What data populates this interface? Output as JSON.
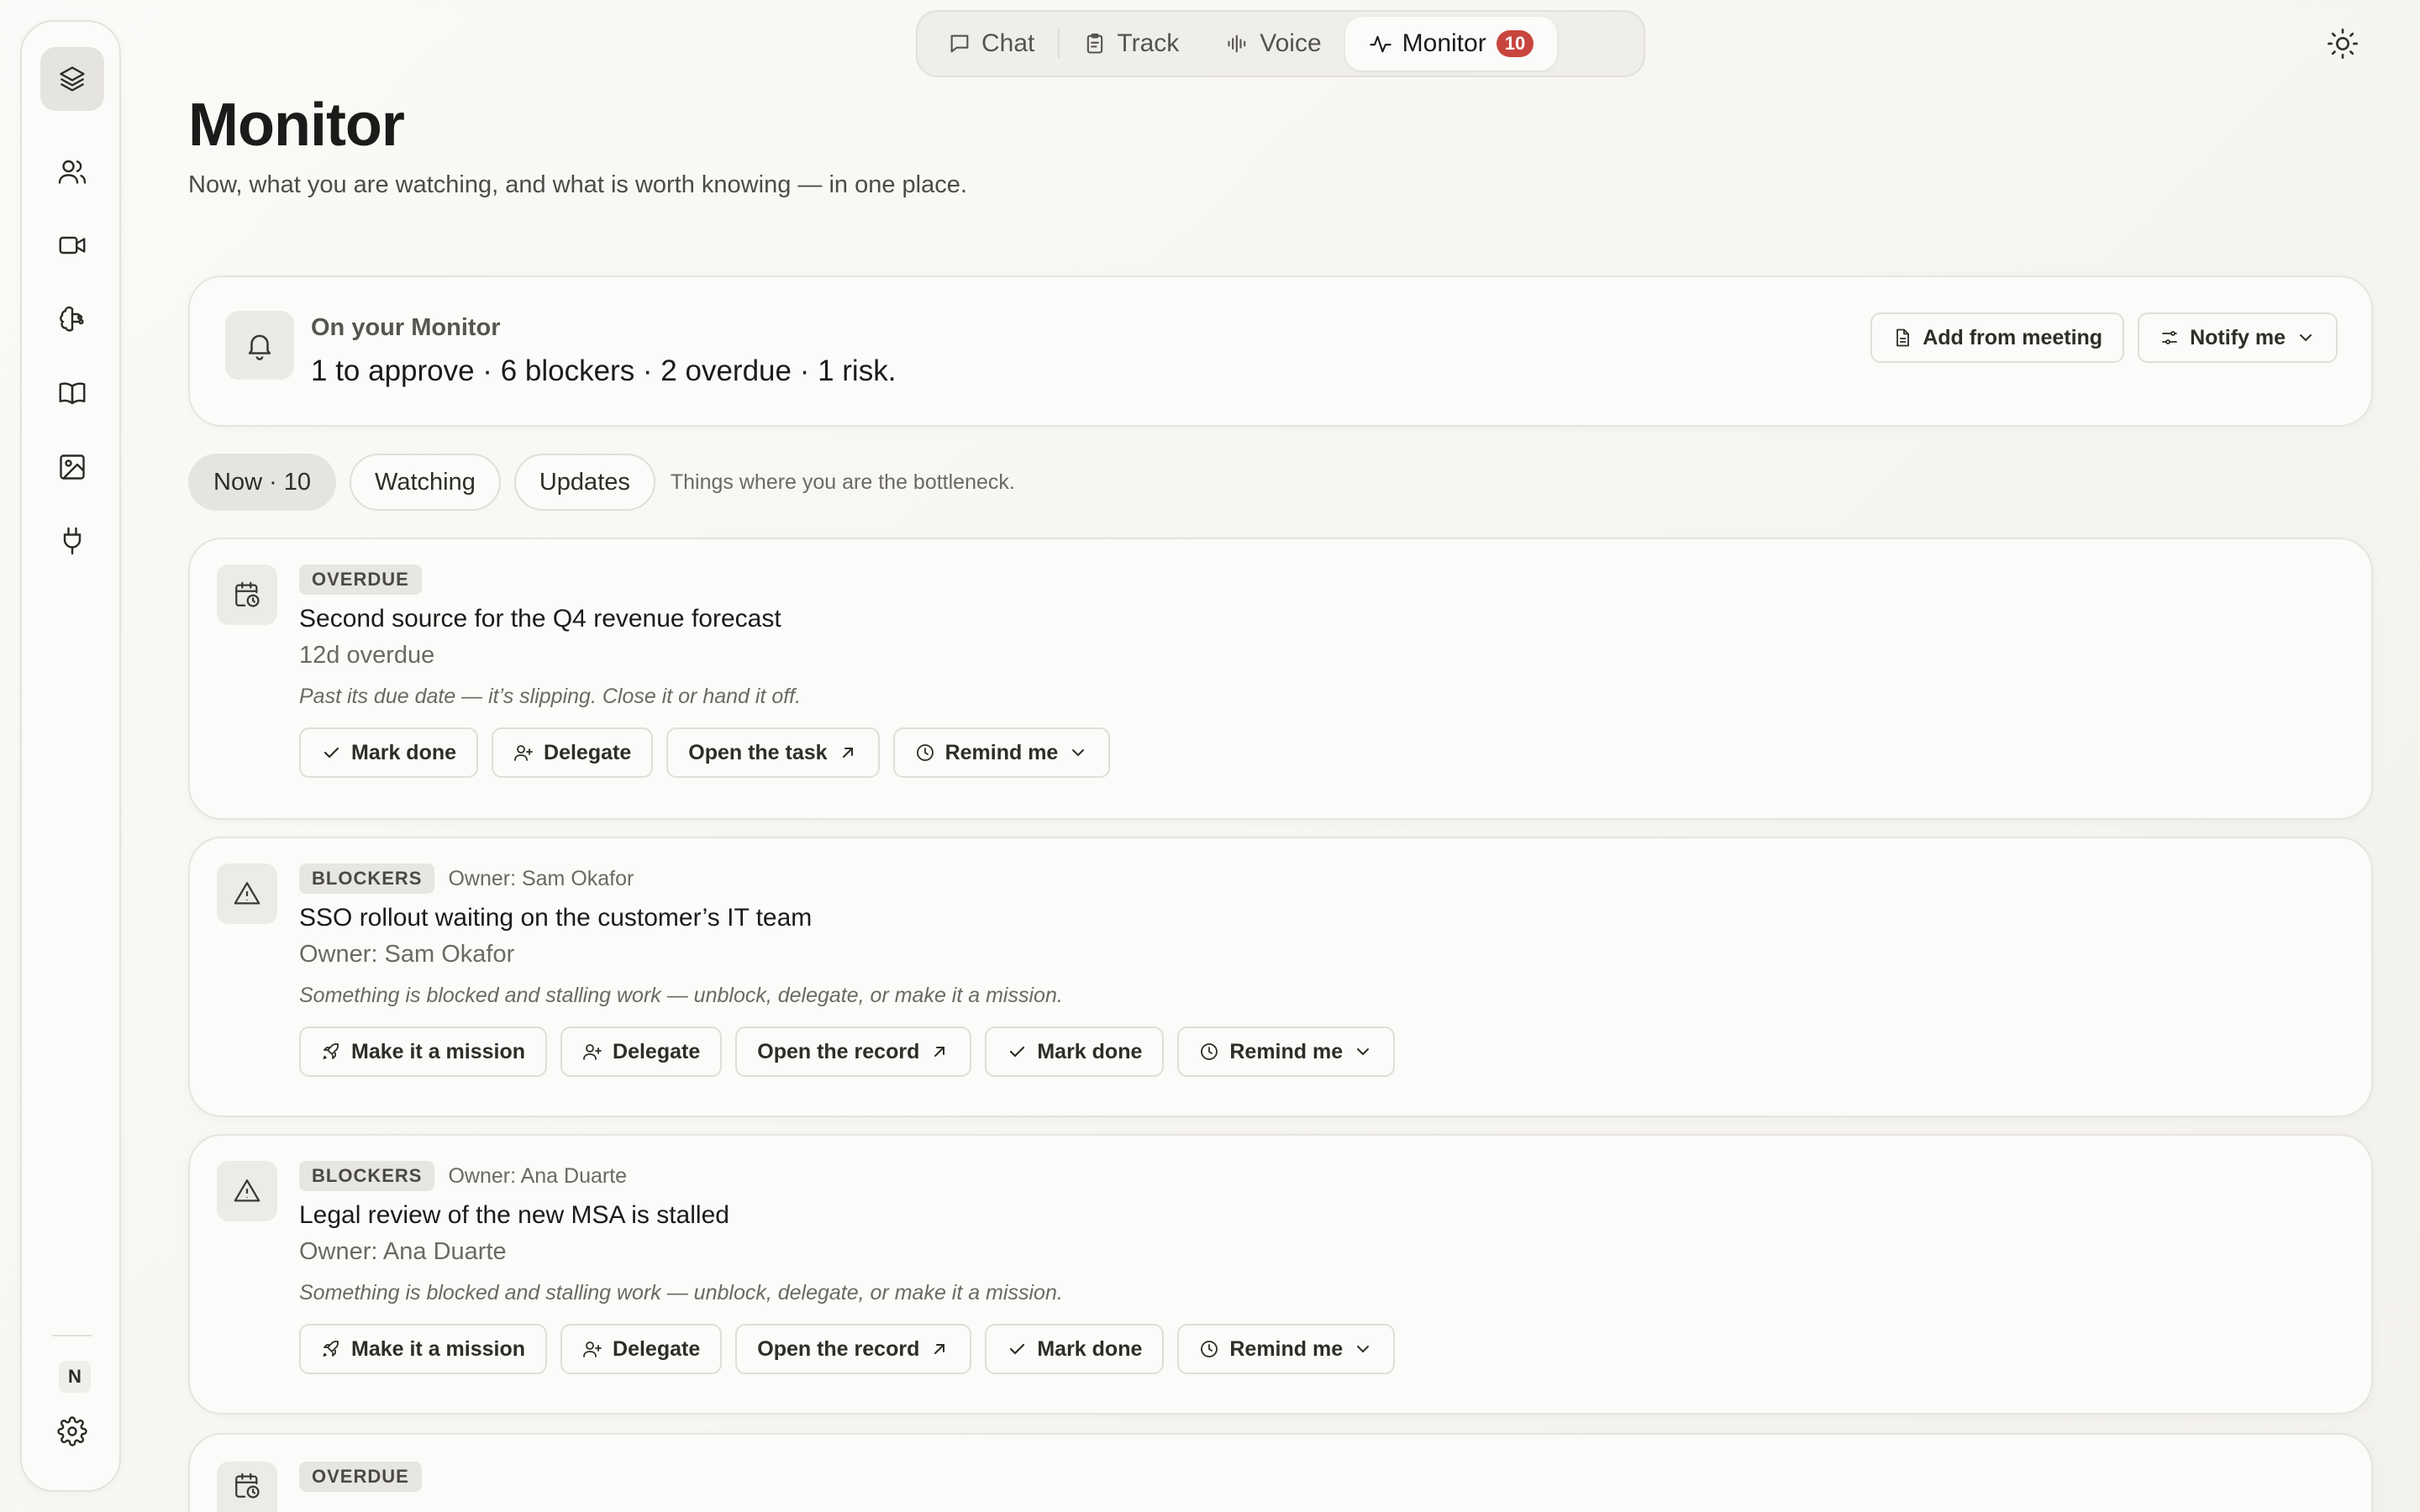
{
  "nav": {
    "tabs": [
      {
        "label": "Chat",
        "icon": "chat-icon"
      },
      {
        "label": "Track",
        "icon": "clipboard-icon"
      },
      {
        "label": "Voice",
        "icon": "waveform-icon"
      },
      {
        "label": "Monitor",
        "icon": "activity-icon",
        "badge": "10"
      }
    ],
    "active": "Monitor"
  },
  "sidebar": {
    "items": [
      "layers-icon",
      "people-icon",
      "video-icon",
      "brain-icon",
      "book-icon",
      "image-icon",
      "plug-icon"
    ],
    "user_initial": "N",
    "settings_icon": "gear-icon"
  },
  "header": {
    "title": "Monitor",
    "subtitle": "Now, what you are watching, and what is worth knowing — in one place."
  },
  "summary": {
    "label": "On your Monitor",
    "text": "1 to approve · 6 blockers · 2 overdue · 1 risk.",
    "add_from_meeting": "Add from meeting",
    "notify_me": "Notify me"
  },
  "filters": {
    "tabs": [
      "Now · 10",
      "Watching",
      "Updates"
    ],
    "note": "Things where you are the bottleneck."
  },
  "items": [
    {
      "tag": "OVERDUE",
      "owner": "",
      "title": "Second source for the Q4 revenue forecast",
      "meta": "12d overdue",
      "note": "Past its due date — it’s slipping. Close it or hand it off.",
      "actions": [
        "Mark done",
        "Delegate",
        "Open the task",
        "Remind me"
      ]
    },
    {
      "tag": "BLOCKERS",
      "owner": "Owner: Sam Okafor",
      "title": "SSO rollout waiting on the customer’s IT team",
      "meta": "Owner: Sam Okafor",
      "note": "Something is blocked and stalling work — unblock, delegate, or make it a mission.",
      "actions": [
        "Make it a mission",
        "Delegate",
        "Open the record",
        "Mark done",
        "Remind me"
      ]
    },
    {
      "tag": "BLOCKERS",
      "owner": "Owner: Ana Duarte",
      "title": "Legal review of the new MSA is stalled",
      "meta": "Owner: Ana Duarte",
      "note": "Something is blocked and stalling work — unblock, delegate, or make it a mission.",
      "actions": [
        "Make it a mission",
        "Delegate",
        "Open the record",
        "Mark done",
        "Remind me"
      ]
    },
    {
      "tag": "OVERDUE"
    }
  ]
}
